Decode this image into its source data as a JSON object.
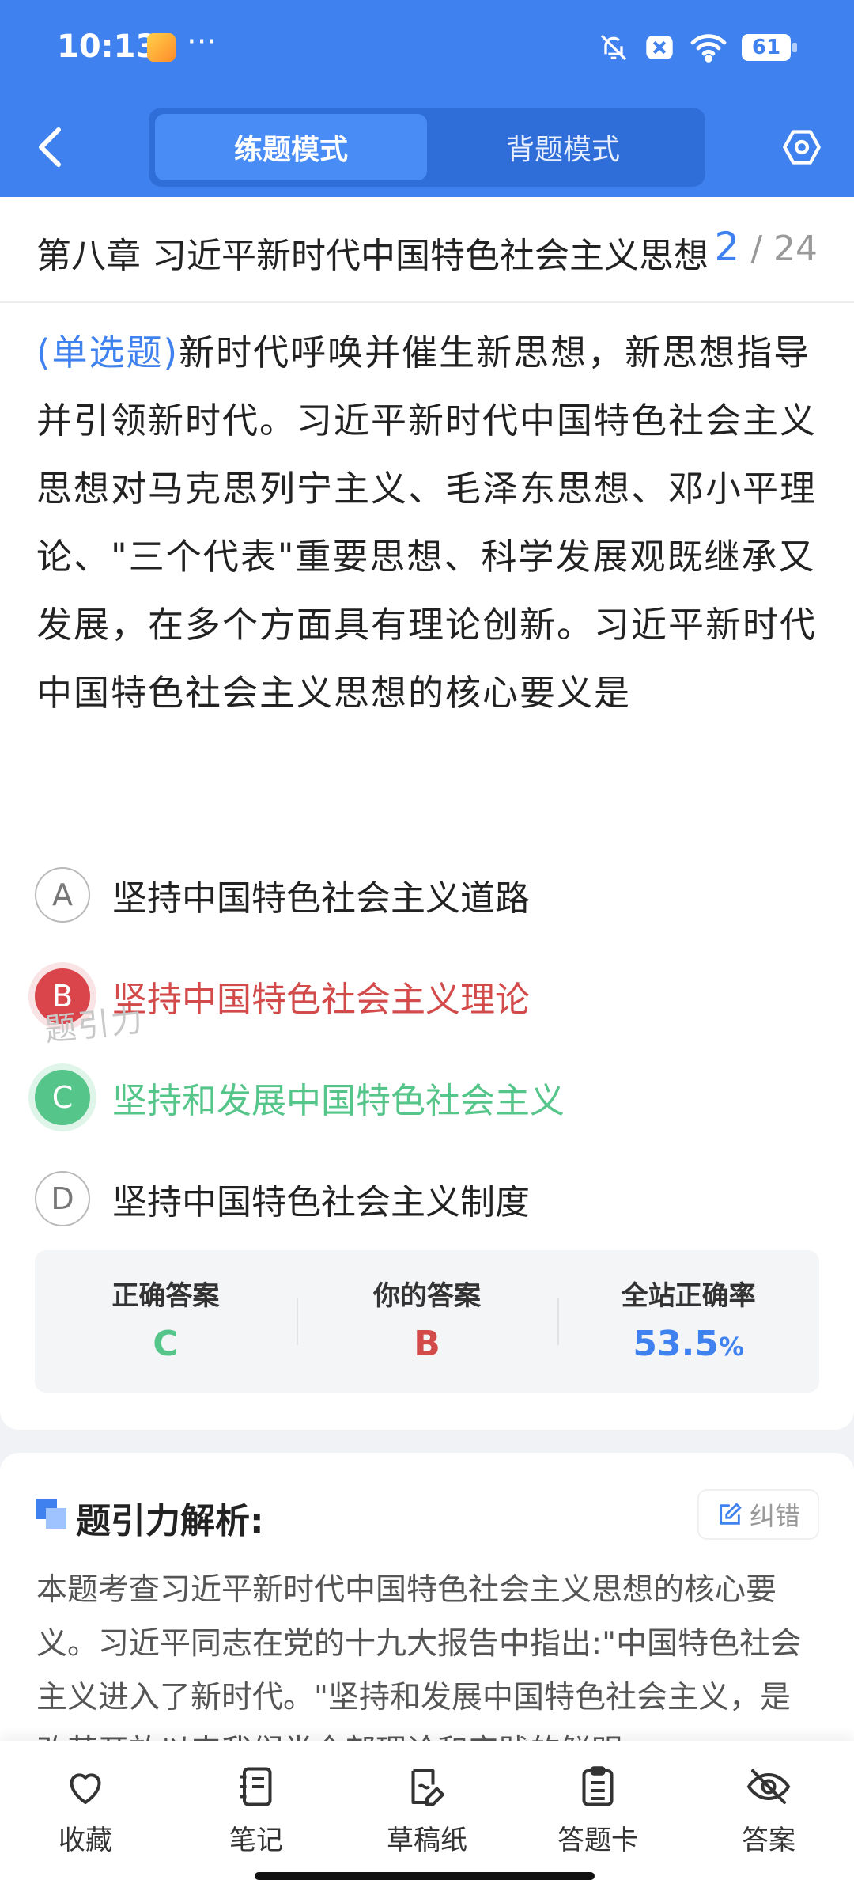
{
  "status_bar": {
    "time": "10:13",
    "dots": "···",
    "battery": "61"
  },
  "header": {
    "mode_tabs": [
      {
        "label": "练题模式",
        "active": true
      },
      {
        "label": "背题模式",
        "active": false
      }
    ]
  },
  "chapter": {
    "title": "第八章 习近平新时代中国特色社会主义思想",
    "current": "2",
    "total": "/ 24"
  },
  "question": {
    "type": "(单选题)",
    "text": "新时代呼唤并催生新思想，新思想指导并引领新时代。习近平新时代中国特色社会主义思想对马克思列宁主义、毛泽东思想、邓小平理论、\"三个代表\"重要思想、科学发展观既继承又发展，在多个方面具有理论创新。习近平新时代中国特色社会主义思想的核心要义是",
    "options": [
      {
        "letter": "A",
        "text": "坚持中国特色社会主义道路",
        "state": "normal"
      },
      {
        "letter": "B",
        "text": "坚持中国特色社会主义理论",
        "state": "wrong"
      },
      {
        "letter": "C",
        "text": "坚持和发展中国特色社会主义",
        "state": "right"
      },
      {
        "letter": "D",
        "text": "坚持中国特色社会主义制度",
        "state": "normal"
      }
    ],
    "watermark": "题引力"
  },
  "result": {
    "correct_label": "正确答案",
    "correct_value": "C",
    "yours_label": "你的答案",
    "yours_value": "B",
    "rate_label": "全站正确率",
    "rate_value": "53.5",
    "rate_unit": "%"
  },
  "analysis": {
    "title": "题引力解析:",
    "report_label": "纠错",
    "text": "本题考查习近平新时代中国特色社会主义思想的核心要义。习近平同志在党的十九大报告中指出:\"中国特色社会主义进入了新时代。\"坚持和发展中国特色社会主义，是改革开放以来我们党全部理论和实践的鲜明"
  },
  "bottom_bar": {
    "items": [
      {
        "label": "收藏",
        "icon": "heart-icon"
      },
      {
        "label": "笔记",
        "icon": "notebook-icon"
      },
      {
        "label": "草稿纸",
        "icon": "draft-pen-icon"
      },
      {
        "label": "答题卡",
        "icon": "clipboard-icon"
      },
      {
        "label": "答案",
        "icon": "eye-off-icon"
      }
    ]
  },
  "colors": {
    "primary": "#3f82ef",
    "wrong": "#d9454a",
    "right": "#55c58a"
  }
}
